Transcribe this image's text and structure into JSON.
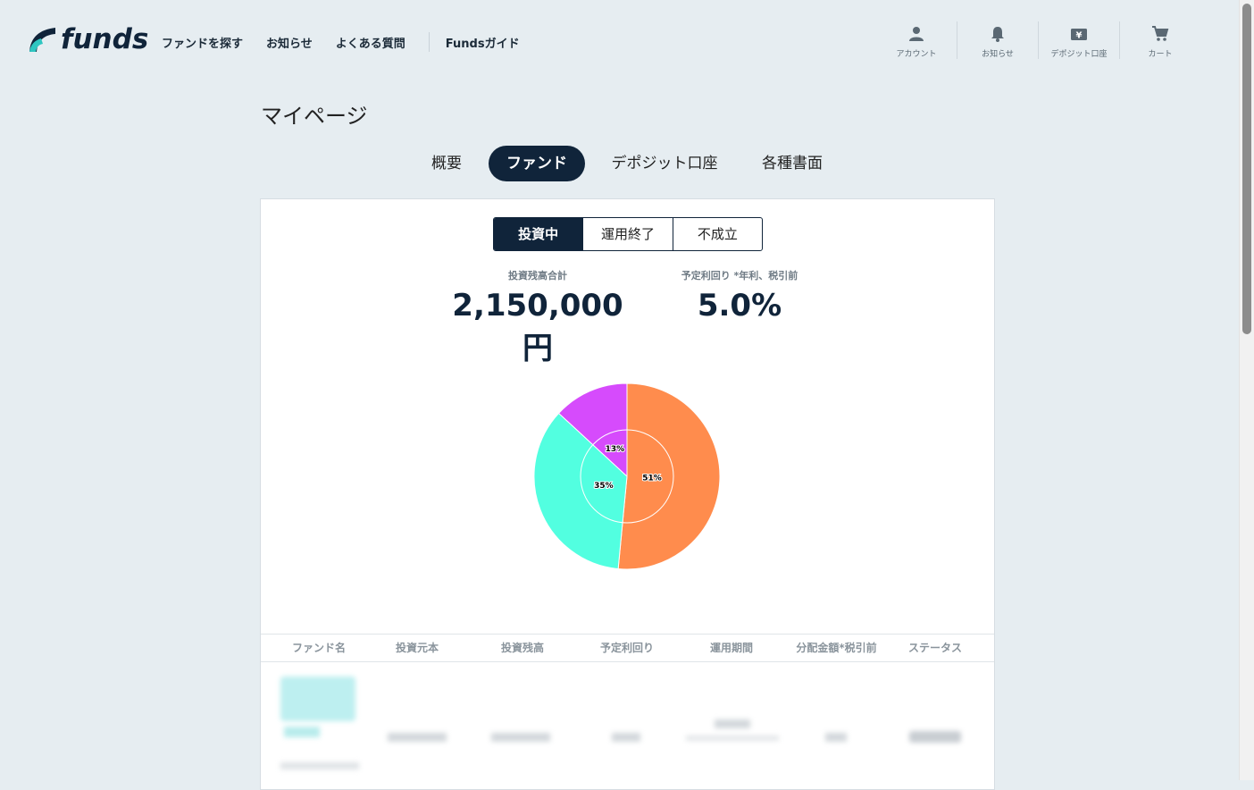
{
  "brand": {
    "name": "funds"
  },
  "nav": [
    "ファンドを探す",
    "お知らせ",
    "よくある質問",
    "Fundsガイド"
  ],
  "header_icons": [
    {
      "label": "アカウント",
      "icon": "person-icon"
    },
    {
      "label": "お知らせ",
      "icon": "bell-icon"
    },
    {
      "label": "デポジット口座",
      "icon": "yen-icon"
    },
    {
      "label": "カート",
      "icon": "cart-icon"
    }
  ],
  "page": {
    "title": "マイページ"
  },
  "tabs": [
    "概要",
    "ファンド",
    "デポジット口座",
    "各種書面"
  ],
  "active_tab": "ファンド",
  "subtabs": [
    "投資中",
    "運用終了",
    "不成立"
  ],
  "active_subtab": "投資中",
  "stats": {
    "total_label": "投資残高合計",
    "total_value": "2,150,000円",
    "yield_label": "予定利回り *年利、税引前",
    "yield_value": "5.0%"
  },
  "chart_data": {
    "type": "pie",
    "slices": [
      {
        "label": "51%",
        "value": 51,
        "color": "#ff8c4d"
      },
      {
        "label": "35%",
        "value": 35,
        "color": "#52ffe0"
      },
      {
        "label": "13%",
        "value": 13,
        "color": "#d64bfc"
      }
    ]
  },
  "table": {
    "headers": [
      "ファンド名",
      "投資元本",
      "投資残高",
      "予定利回り",
      "運用期間",
      "分配金額*税引前",
      "ステータス"
    ]
  }
}
